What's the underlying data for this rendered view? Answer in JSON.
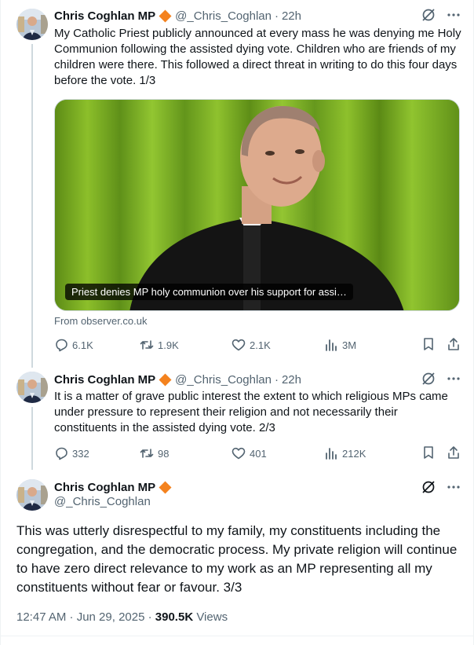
{
  "author": {
    "name": "Chris Coghlan MP",
    "handle": "@_Chris_Coghlan"
  },
  "tweets": [
    {
      "time": "22h",
      "text": "My Catholic Priest publicly announced at every mass he was denying me Holy Communion following the assisted dying vote. Children who are friends of my children were there. This followed a direct threat in writing to do this four days before the vote. 1/3",
      "card": {
        "caption": "Priest denies MP holy communion over his support for assi…",
        "source": "From observer.co.uk"
      },
      "stats": {
        "replies": "6.1K",
        "reposts": "1.9K",
        "likes": "2.1K",
        "views": "3M"
      }
    },
    {
      "time": "22h",
      "text": "It is a matter of grave public interest the extent to which religious MPs came under pressure to represent their religion and not necessarily their constituents in the assisted dying vote. 2/3",
      "stats": {
        "replies": "332",
        "reposts": "98",
        "likes": "401",
        "views": "212K"
      }
    }
  ],
  "main_tweet": {
    "text": "This was utterly disrespectful to my family, my constituents including the congregation, and the democratic process. My private religion will continue to have zero direct relevance to my work as an MP representing all my constituents without fear or favour. 3/3",
    "timestamp": "12:47 AM · Jun 29, 2025 · ",
    "views_count": "390.5K",
    "views_label": " Views"
  },
  "sep": "·",
  "colors": {
    "verified": "#f4821e",
    "secondary_text": "#536471",
    "thread_line": "#cfd9de"
  },
  "icons": [
    "verified-badge-icon",
    "grok-icon",
    "more-icon",
    "reply-icon",
    "repost-icon",
    "like-icon",
    "views-icon",
    "bookmark-icon",
    "share-icon"
  ]
}
